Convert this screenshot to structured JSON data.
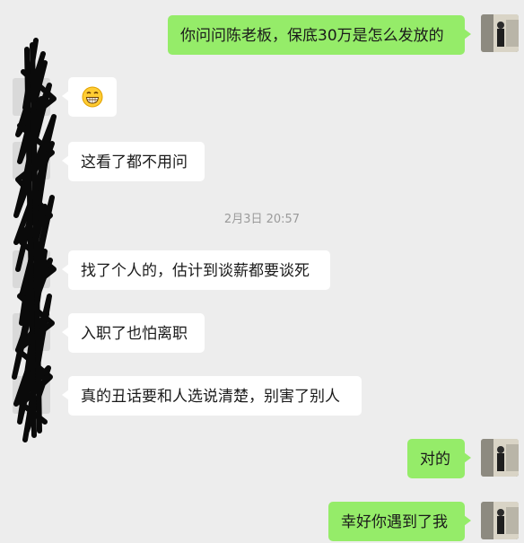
{
  "timestamp": "2月3日 20:57",
  "messages": [
    {
      "side": "out",
      "text": "你问问陈老板，保底30万是怎么发放的"
    },
    {
      "side": "in",
      "text": "",
      "emoji": "grinning-face-icon"
    },
    {
      "side": "in",
      "text": "这看了都不用问"
    },
    {
      "side": "in",
      "text": "找了个人的，估计到谈薪都要谈死"
    },
    {
      "side": "in",
      "text": "入职了也怕离职"
    },
    {
      "side": "in",
      "text": "真的丑话要和人选说清楚，别害了别人"
    },
    {
      "side": "out",
      "text": "对的"
    },
    {
      "side": "out",
      "text": "幸好你遇到了我"
    }
  ],
  "colors": {
    "background": "#ededed",
    "outgoing_bubble": "#95ec69",
    "incoming_bubble": "#ffffff",
    "timestamp_text": "#9a9a9a"
  }
}
